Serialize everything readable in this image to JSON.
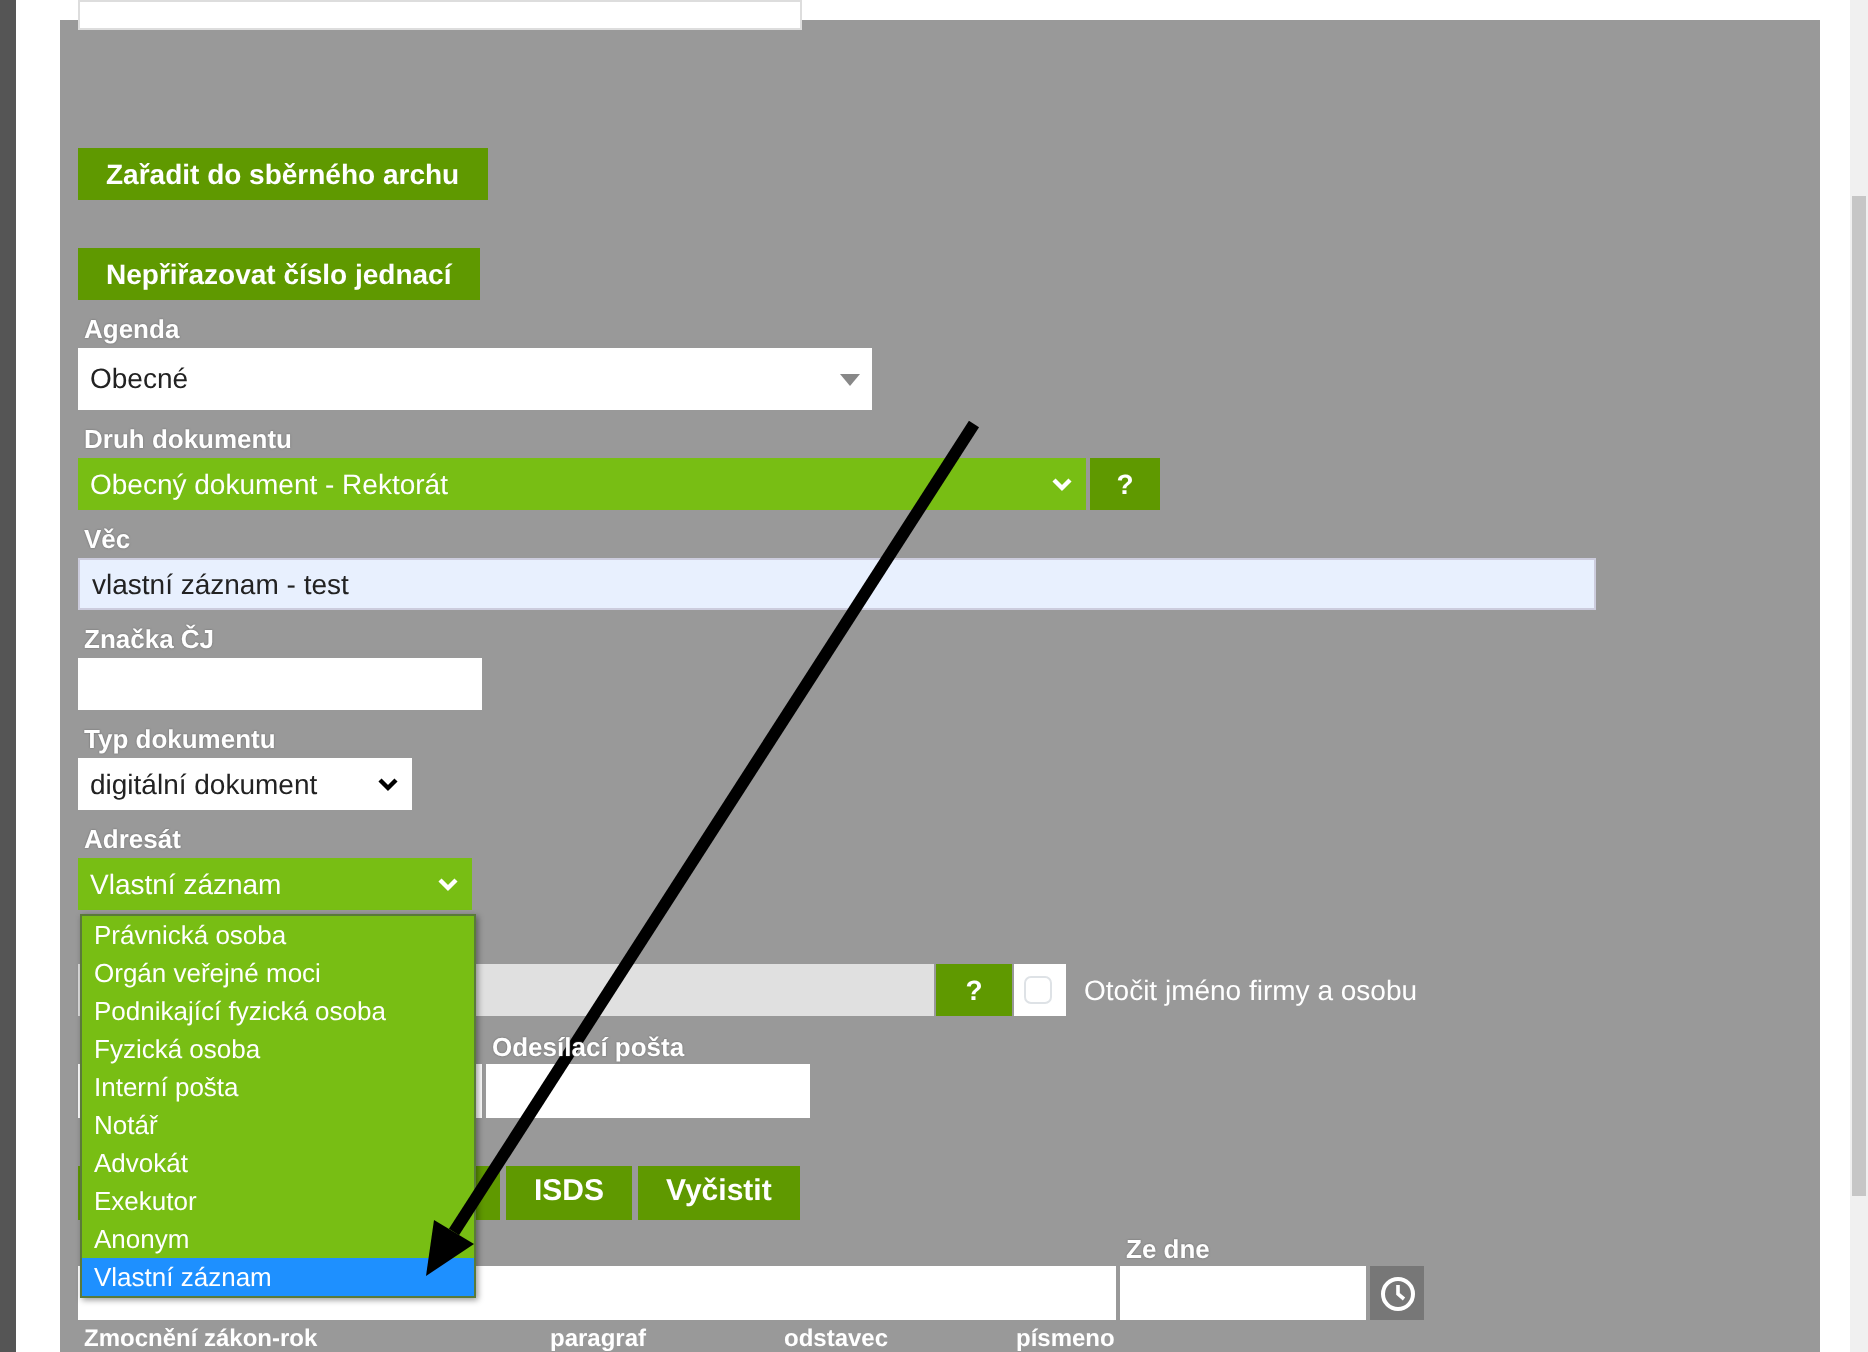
{
  "buttons": [
    {
      "label": "Zařadit do sběrného archu"
    },
    {
      "label": "Nepřiřazovat číslo jednací"
    }
  ],
  "fields": [
    {
      "kind": "select",
      "label": "Agenda",
      "value": "Obecné"
    },
    {
      "kind": "green_select",
      "label": "Druh dokumentu",
      "value": "Obecný dokument - Rektorát",
      "help": "?"
    },
    {
      "kind": "text",
      "label": "Věc",
      "value": "vlastní záznam - test"
    },
    {
      "kind": "short_text",
      "label": "Značka ČJ"
    },
    {
      "kind": "native_select",
      "label": "Typ dokumentu",
      "value": "digitální dokument"
    }
  ],
  "recipient": {
    "label": "Adresát",
    "value": "Vlastní záznam",
    "expanded": true,
    "options": [
      {
        "label": "Právnická osoba",
        "selected": false
      },
      {
        "label": "Orgán veřejné moci",
        "selected": false
      },
      {
        "label": "Podnikající fyzická osoba",
        "selected": false
      },
      {
        "label": "Fyzická osoba",
        "selected": false
      },
      {
        "label": "Interní pošta",
        "selected": false
      },
      {
        "label": "Notář",
        "selected": false
      },
      {
        "label": "Advokát",
        "selected": false
      },
      {
        "label": "Exekutor",
        "selected": false
      },
      {
        "label": "Anonym",
        "selected": false
      },
      {
        "label": "Vlastní záznam",
        "selected": true
      }
    ]
  },
  "recipient_row": {
    "help": "?",
    "swap_checkbox": {
      "label": "Otočit jméno firmy a osobu",
      "checked": false
    }
  },
  "sender_post": {
    "label": "Odesílací pošta"
  },
  "actions": [
    "ISDS",
    "Vyčistit"
  ],
  "date": {
    "label": "Ze dne"
  },
  "authorization_columns": [
    "Zmocnění zákon-rok",
    "paragraf",
    "odstavec",
    "písmeno"
  ]
}
